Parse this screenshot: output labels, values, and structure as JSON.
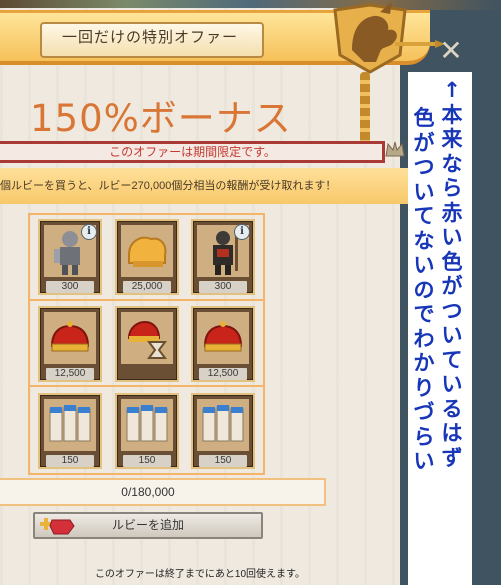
{
  "dialog": {
    "title": "一回だけの特別オファー",
    "close_glyph": "✕",
    "headline": "150%ボーナス",
    "notice": "このオファーは期間限定です。",
    "info": "個ルビーを買うと、ルビー270,000個分相当の報酬が受け取れます！",
    "rewards": [
      {
        "label": "300",
        "icon": "armored-knight-icon",
        "info": "i"
      },
      {
        "label": "25,000",
        "icon": "bread-food-icon"
      },
      {
        "label": "300",
        "icon": "dark-warrior-icon",
        "info": "i"
      },
      {
        "label": "12,500",
        "icon": "crown-icon"
      },
      {
        "label": "",
        "icon": "crown-hourglass-icon"
      },
      {
        "label": "12,500",
        "icon": "crown-icon"
      },
      {
        "label": "150",
        "icon": "scroll-bundle-icon"
      },
      {
        "label": "150",
        "icon": "scroll-bundle-icon"
      },
      {
        "label": "150",
        "icon": "scroll-bundle-icon"
      }
    ],
    "progress": "0/180,000",
    "add_button": "ルビーを追加",
    "footer": "このオファーは終了までにあと10回使えます。"
  },
  "annotation": {
    "col1": "↑本来なら赤い色がついているはず",
    "col2": "色がついてないのでわかりづらい"
  },
  "colors": {
    "headline": "#d97636",
    "notice_border": "#a93a36",
    "annotation": "#1736b8"
  }
}
